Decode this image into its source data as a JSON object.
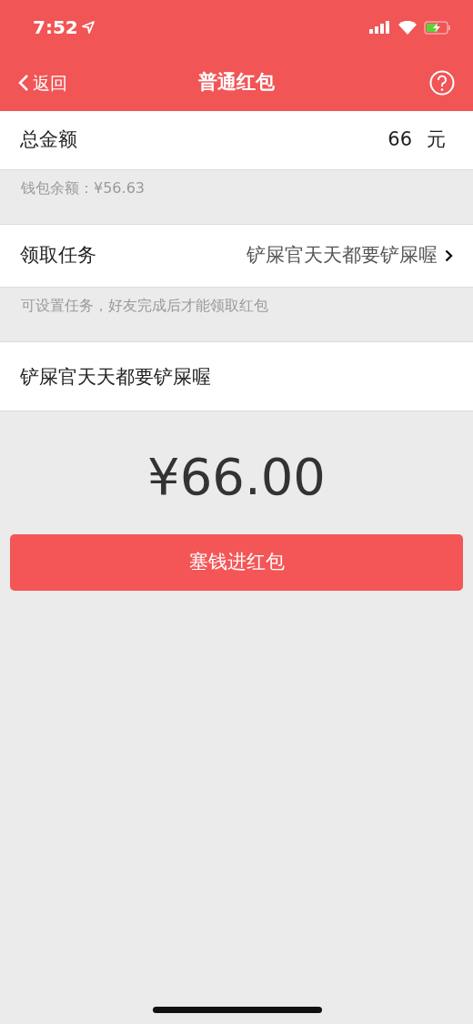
{
  "status_bar": {
    "time": "7:52"
  },
  "nav": {
    "back": "返回",
    "title": "普通红包"
  },
  "amount_row": {
    "label": "总金额",
    "value": "66",
    "unit": "元"
  },
  "balance_note": "钱包余额：¥56.63",
  "task_row": {
    "label": "领取任务",
    "value": "铲屎官天天都要铲屎喔"
  },
  "task_note": "可设置任务，好友完成后才能领取红包",
  "message": {
    "value": "铲屎官天天都要铲屎喔"
  },
  "total": "¥66.00",
  "submit_button": "塞钱进红包"
}
